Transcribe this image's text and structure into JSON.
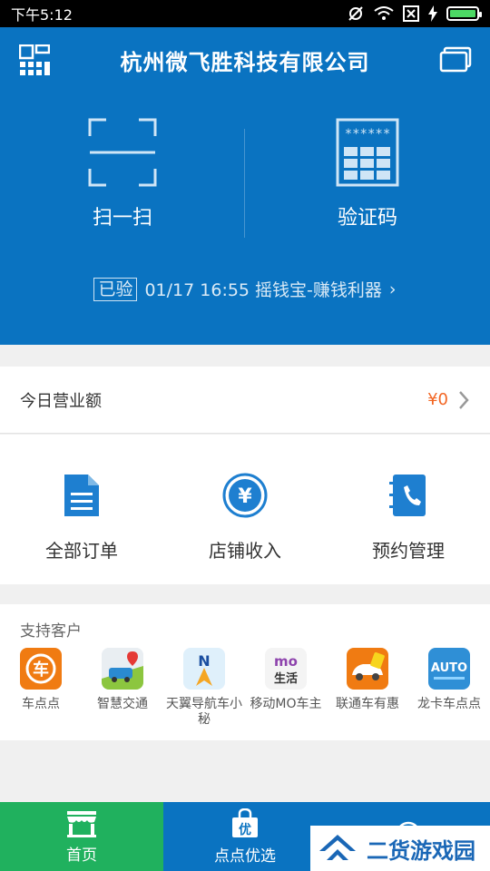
{
  "status_bar": {
    "time": "下午5:12",
    "battery_level": 1.0
  },
  "header": {
    "title": "杭州微飞胜科技有限公司",
    "scan_label": "扫一扫",
    "code_label": "验证码",
    "code_mask": "******",
    "verified_badge": "已验",
    "verified_text": "01/17 16:55 摇钱宝-赚钱利器",
    "verified_chevron": "›"
  },
  "income": {
    "label": "今日营业额",
    "value": "¥0",
    "chevron": "›"
  },
  "functions": [
    {
      "label": "全部订单",
      "icon": "document-icon"
    },
    {
      "label": "店铺收入",
      "icon": "yen-coin-icon"
    },
    {
      "label": "预约管理",
      "icon": "phone-book-icon"
    }
  ],
  "clients": {
    "title": "支持客户",
    "items": [
      {
        "name": "车点点",
        "logo_text": "车"
      },
      {
        "name": "智慧交通",
        "logo_text": ""
      },
      {
        "name": "天翼导航车小秘",
        "logo_text": "N"
      },
      {
        "name": "移动MO车主",
        "logo_text": "mo生活"
      },
      {
        "name": "联通车有惠",
        "logo_text": ""
      },
      {
        "name": "龙卡车点点",
        "logo_text": "AUTO"
      }
    ]
  },
  "bottom_nav": {
    "home": "首页",
    "select": "点点优选",
    "select_badge": "优"
  },
  "watermark": {
    "text": "二货游戏园"
  },
  "colors": {
    "brand_blue": "#0a73c1",
    "nav_green": "#20b15e",
    "price_orange": "#f26522"
  }
}
